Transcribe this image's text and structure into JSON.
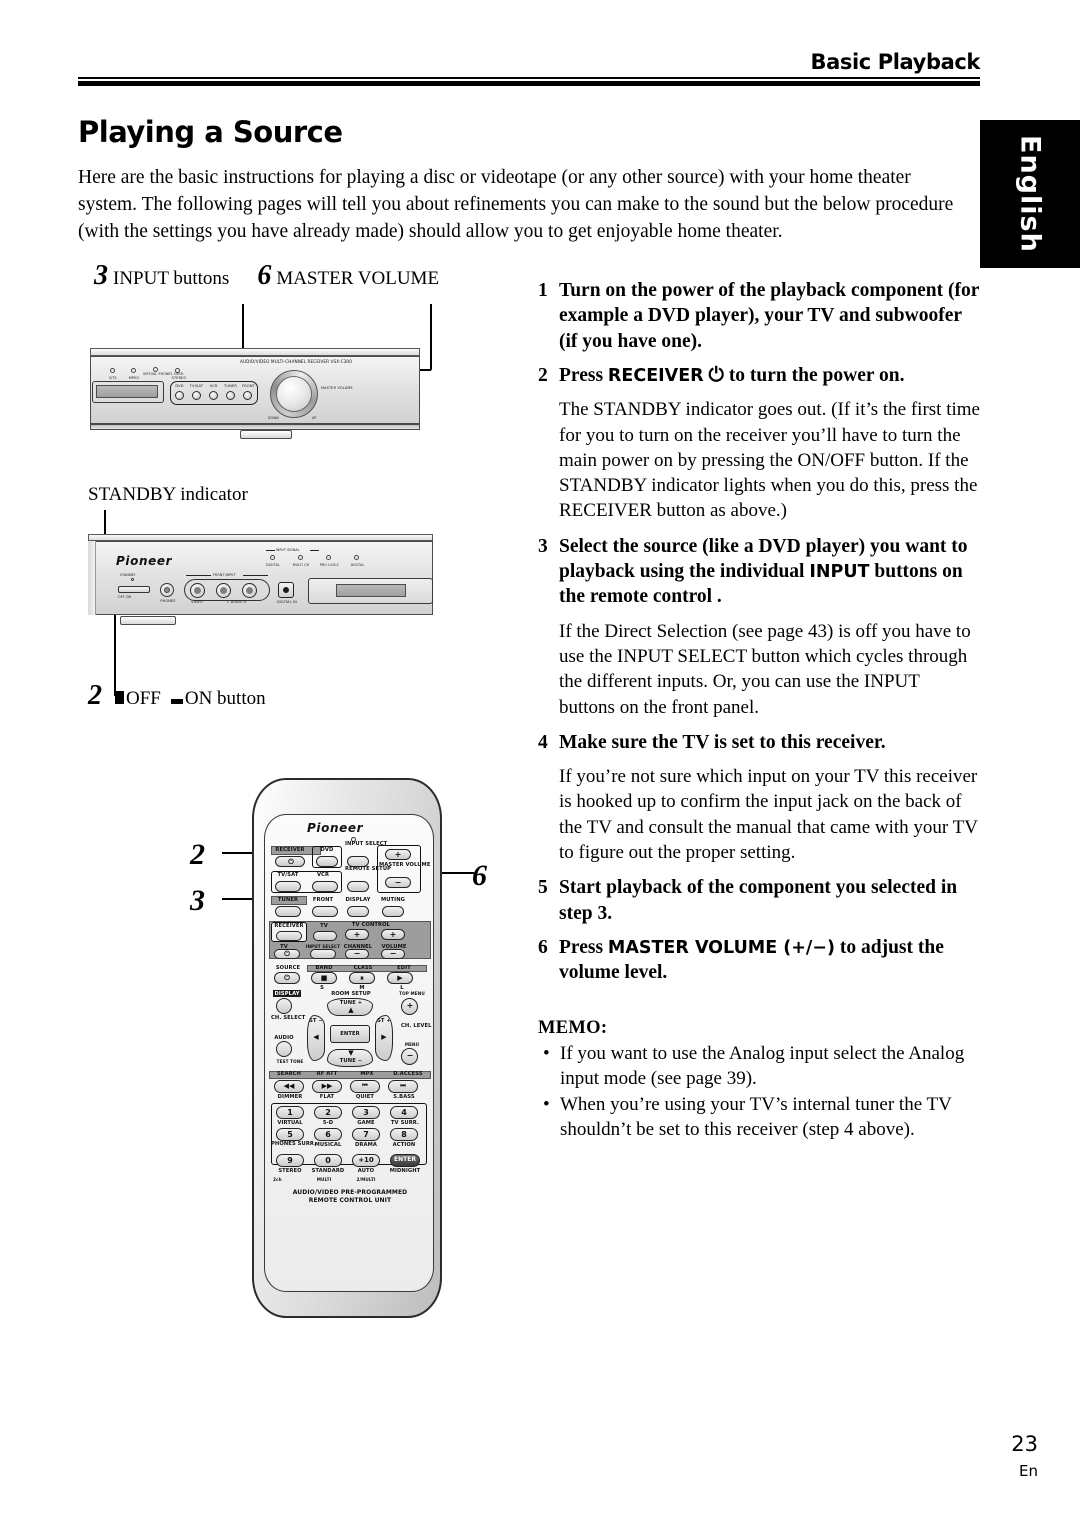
{
  "header": {
    "section_title": "Basic Playback"
  },
  "lang_tab": {
    "label": "English"
  },
  "page": {
    "title": "Playing a Source",
    "number": "23",
    "suffix": "En"
  },
  "intro": {
    "text": "Here are the basic instructions for playing a disc or videotape (or any other source) with your home theater system. The following pages will tell you about refinements you can make to the sound but the below procedure (with the settings you have already made) should allow you to get enjoyable home theater."
  },
  "callouts": {
    "input_buttons": {
      "num": "3",
      "label": "INPUT buttons"
    },
    "master_volume": {
      "num": "6",
      "label": "MASTER VOLUME"
    },
    "standby_indicator": {
      "label": "STANDBY indicator"
    },
    "off_on_button": {
      "num": "2",
      "label_off": "OFF",
      "label_on": "ON button"
    },
    "remote_2": "2",
    "remote_3": "3",
    "remote_6": "6"
  },
  "receiver_main": {
    "model_text": "AUDIO/VIDEO MULTI-CHANNEL RECEIVER VSX-C300",
    "indicators": [
      "DTS",
      "MPEG",
      "VIRTUAL PHONES SURR.",
      "STEREO"
    ],
    "input_buttons": [
      "DVD",
      "TV/SAT",
      "VCR",
      "TUNER",
      "FRONT"
    ],
    "volume_label": "MASTER VOLUME",
    "volume_down": "DOWN",
    "volume_up": "UP"
  },
  "receiver_front": {
    "brand": "Pioneer",
    "input_signal_label": "INPUT SIGNAL",
    "signal_indicators": [
      "DIGITAL",
      "MULTI CH",
      "PRO LOGIC",
      "DIGITAL"
    ],
    "standby_label": "STANDBY",
    "power_label": "OFF    ON",
    "phones_label": "PHONES",
    "front_input_label": "FRONT INPUT",
    "jack_labels": [
      "VIDEO",
      "L   AUDIO   R"
    ],
    "digital_in_label": "DIGITAL IN"
  },
  "remote": {
    "brand": "Pioneer",
    "row1": [
      "RECEIVER",
      "DVD",
      "INPUT SELECT",
      "+"
    ],
    "row2": [
      "TV/SAT",
      "VCR",
      "REMOTE SETUP",
      "MASTER VOLUME"
    ],
    "row3": [
      "TUNER",
      "FRONT",
      "DISPLAY",
      "MUTING"
    ],
    "minus": "−",
    "row4": [
      "RECEIVER",
      "TV",
      "TV CONTROL"
    ],
    "row5": [
      "TV",
      "INPUT SELECT",
      "CHANNEL",
      "VOLUME"
    ],
    "source_label": "SOURCE",
    "transport": {
      "band": "BAND",
      "class": "CLASS",
      "edit": "EDIT",
      "s": "S",
      "m": "M",
      "l": "L"
    },
    "room_setup": "ROOM SETUP",
    "display": "DISPLAY",
    "ch_select": "CH. SELECT",
    "audio": "AUDIO",
    "test_tone": "TEST TONE",
    "tune_up": "TUNE +",
    "tune_down": "TUNE −",
    "st_minus": "ST −",
    "st_plus": "ST +",
    "enter": "ENTER",
    "top_menu": "TOP MENU",
    "menu": "MENU",
    "ch_level": "CH. LEVEL",
    "fn_top": [
      "SEARCH",
      "RF ATT",
      "MPX",
      "D.ACCESS"
    ],
    "fn_bottom": [
      "DIMMER",
      "FLAT",
      "QUIET",
      "S.BASS"
    ],
    "keys": [
      {
        "digit": "1",
        "label": "VIRTUAL"
      },
      {
        "digit": "2",
        "label": "5-D"
      },
      {
        "digit": "3",
        "label": "GAME"
      },
      {
        "digit": "4",
        "label": "TV SURR."
      },
      {
        "digit": "5",
        "label": "PHONES SURR."
      },
      {
        "digit": "6",
        "label": "MUSICAL"
      },
      {
        "digit": "7",
        "label": "DRAMA"
      },
      {
        "digit": "8",
        "label": "ACTION"
      },
      {
        "digit": "9",
        "label": "STEREO"
      },
      {
        "digit": "0",
        "label": "STANDARD"
      },
      {
        "digit": "+10",
        "label": "AUTO"
      },
      {
        "digit": "ENTER",
        "label": "MIDNIGHT"
      }
    ],
    "mode_labels": [
      "2ch",
      "MULTI",
      "2/MULTI"
    ],
    "footer_line1": "AUDIO/VIDEO PRE-PROGRAMMED",
    "footer_line2": "REMOTE CONTROL UNIT"
  },
  "steps": [
    {
      "num": "1",
      "title_parts": [
        {
          "t": "Turn on the power of the playback component (for example a DVD player), your TV and subwoofer (if you have one).",
          "style": "serif"
        }
      ],
      "body": ""
    },
    {
      "num": "2",
      "title_parts": [
        {
          "t": "Press ",
          "style": "serif"
        },
        {
          "t": "RECEIVER",
          "style": "sans"
        },
        {
          "t": " ⏻ to turn the power on.",
          "style": "serif"
        }
      ],
      "body": "The STANDBY indicator goes out. (If it’s the first time for you to turn on the receiver you’ll have to turn the main power on by pressing the ON/OFF button. If the STANDBY indicator lights when you do this, press the RECEIVER button as above.)"
    },
    {
      "num": "3",
      "title_parts": [
        {
          "t": "Select the source (like a DVD player) you want to playback using the individual ",
          "style": "serif"
        },
        {
          "t": "INPUT",
          "style": "sans"
        },
        {
          "t": " buttons on the remote control .",
          "style": "serif"
        }
      ],
      "body": "If the Direct Selection (see page 43) is off you have to use the INPUT SELECT button which cycles through the different inputs. Or, you can use the INPUT buttons on the front panel."
    },
    {
      "num": "4",
      "title_parts": [
        {
          "t": "Make sure the TV is set to this receiver.",
          "style": "serif"
        }
      ],
      "body": "If you’re not sure which input on your TV this receiver is hooked up to confirm the input jack on the back of the TV and consult the manual that came with your TV to figure out the proper setting."
    },
    {
      "num": "5",
      "title_parts": [
        {
          "t": "Start playback of the component you selected in step 3.",
          "style": "serif"
        }
      ],
      "body": ""
    },
    {
      "num": "6",
      "title_parts": [
        {
          "t": "Press ",
          "style": "serif"
        },
        {
          "t": "MASTER VOLUME (+/−)",
          "style": "sans"
        },
        {
          "t": " to adjust the volume level.",
          "style": "serif"
        }
      ],
      "body": ""
    }
  ],
  "memo": {
    "heading": "MEMO:",
    "items": [
      "If you want to use the Analog input select the Analog input mode (see page 39).",
      "When you’re using your TV’s internal tuner the TV shouldn’t be set to this receiver (step 4 above)."
    ]
  }
}
